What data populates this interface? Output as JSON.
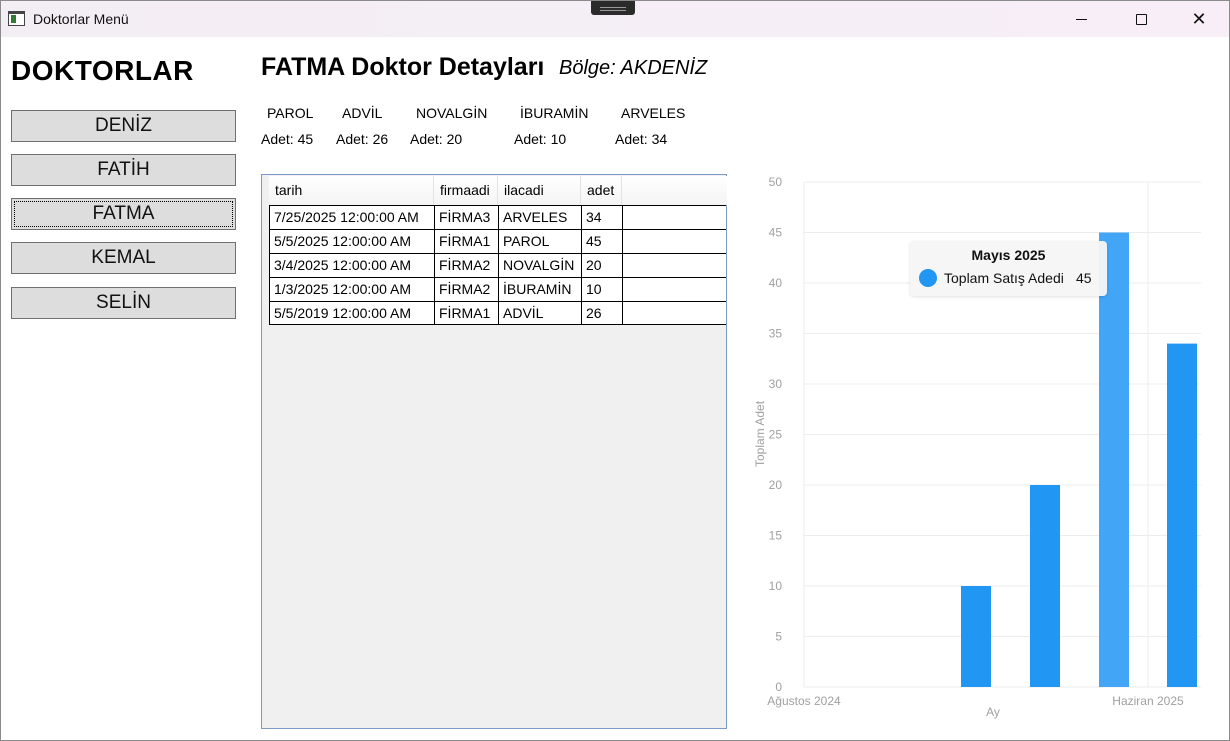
{
  "window": {
    "title": "Doktorlar Menü"
  },
  "sidebar": {
    "title": "DOKTORLAR",
    "doctors": [
      {
        "label": "DENİZ"
      },
      {
        "label": "FATİH"
      },
      {
        "label": "FATMA",
        "selected": true
      },
      {
        "label": "KEMAL"
      },
      {
        "label": "SELİN"
      }
    ]
  },
  "details": {
    "heading": "FATMA Doktor Detayları",
    "region": "Bölge: AKDENİZ",
    "drugs": [
      {
        "name": "PAROL",
        "count": "Adet: 45"
      },
      {
        "name": "ADVİL",
        "count": "Adet: 26"
      },
      {
        "name": "NOVALGİN",
        "count": "Adet: 20"
      },
      {
        "name": "İBURAMİN",
        "count": "Adet: 10"
      },
      {
        "name": "ARVELES",
        "count": "Adet: 34"
      }
    ]
  },
  "grid": {
    "columns": [
      "tarih",
      "firmaadi",
      "ilacadi",
      "adet"
    ],
    "rows": [
      [
        "7/25/2025 12:00:00 AM",
        "FİRMA3",
        "ARVELES",
        "34"
      ],
      [
        "5/5/2025 12:00:00 AM",
        "FİRMA1",
        "PAROL",
        "45"
      ],
      [
        "3/4/2025 12:00:00 AM",
        "FİRMA2",
        "NOVALGİN",
        "20"
      ],
      [
        "1/3/2025 12:00:00 AM",
        "FİRMA2",
        "İBURAMİN",
        "10"
      ],
      [
        "5/5/2019 12:00:00 AM",
        "FİRMA1",
        "ADVİL",
        "26"
      ]
    ]
  },
  "chart_data": {
    "type": "bar",
    "xlabel": "Ay",
    "ylabel": "Toplam Adet",
    "ylim": [
      0,
      50
    ],
    "yticks": [
      0,
      5,
      10,
      15,
      20,
      25,
      30,
      35,
      40,
      45,
      50
    ],
    "xtick_labels": [
      "Ağustos 2024",
      "Haziran 2025"
    ],
    "grid": true,
    "bar_color": "#2196f3",
    "highlight_color": "#42a5f5",
    "series": [
      {
        "name": "Toplam Satış Adedi",
        "values": [
          10,
          20,
          45,
          34
        ]
      }
    ],
    "tooltip": {
      "title": "Mayıs 2025",
      "label": "Toplam Satış Adedi",
      "value": "45"
    }
  }
}
